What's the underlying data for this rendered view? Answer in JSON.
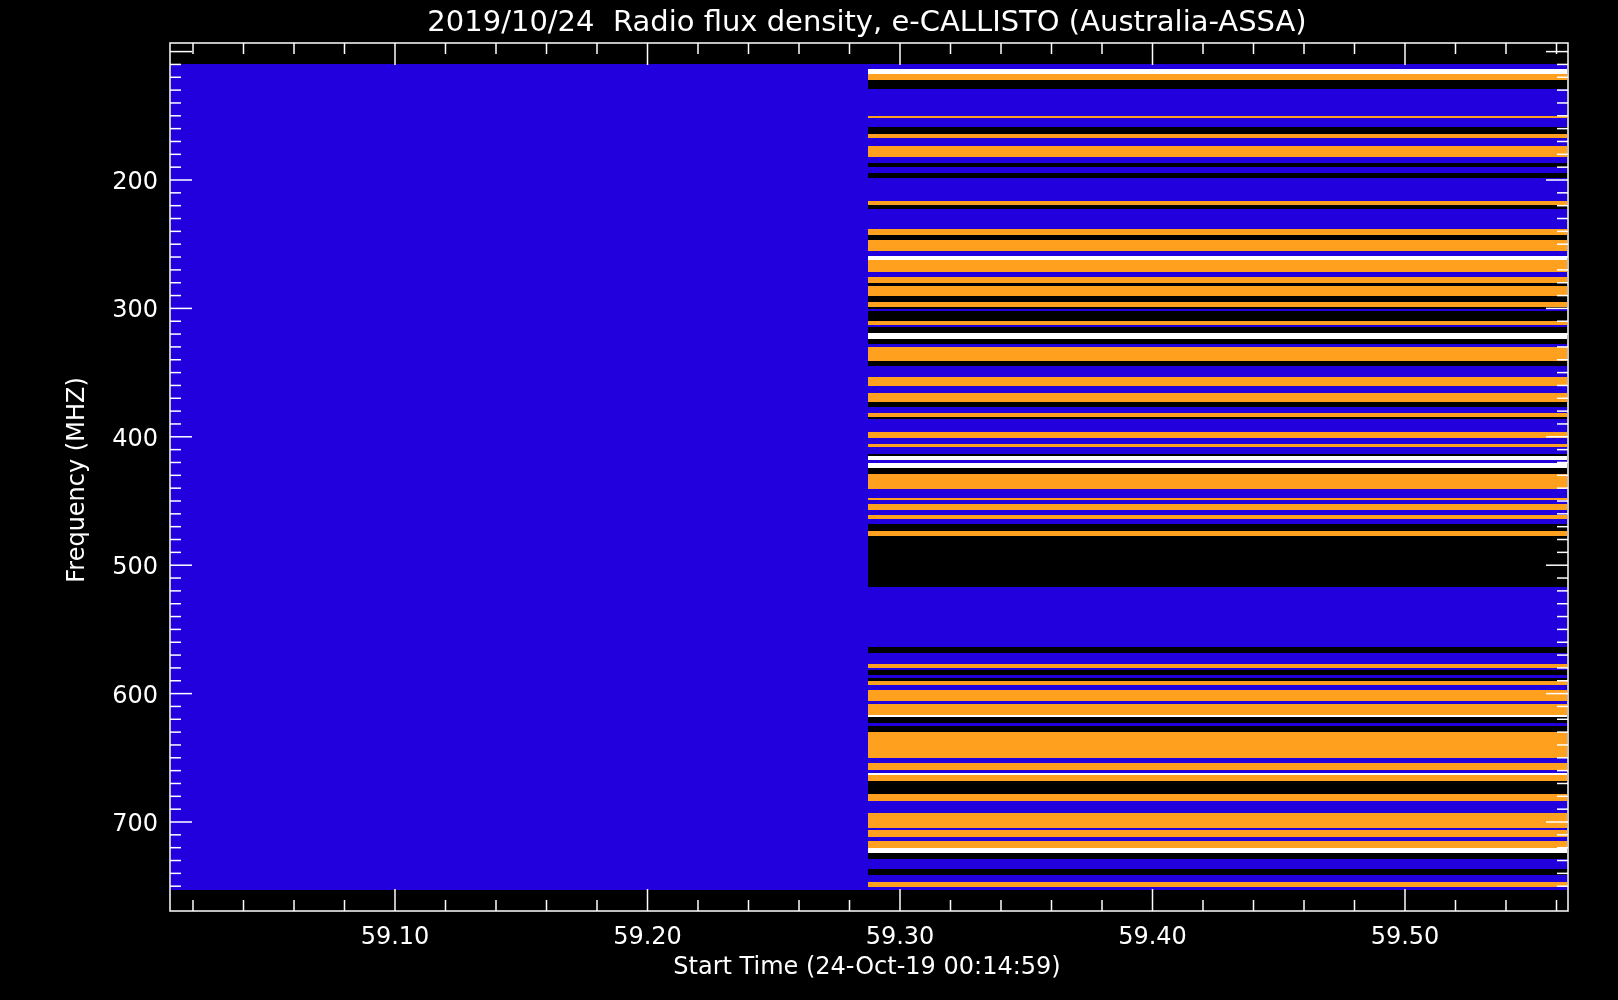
{
  "title": "2019/10/24  Radio flux density, e-CALLISTO (Australia-ASSA)",
  "x_axis": {
    "label": "Start Time (24-Oct-19 00:14:59)",
    "ticks": [
      "59.10",
      "59.20",
      "59.30",
      "59.40",
      "59.50"
    ]
  },
  "y_axis": {
    "label": "Frequency (MHZ)",
    "ticks": [
      "200",
      "300",
      "400",
      "500",
      "600",
      "700"
    ]
  }
}
